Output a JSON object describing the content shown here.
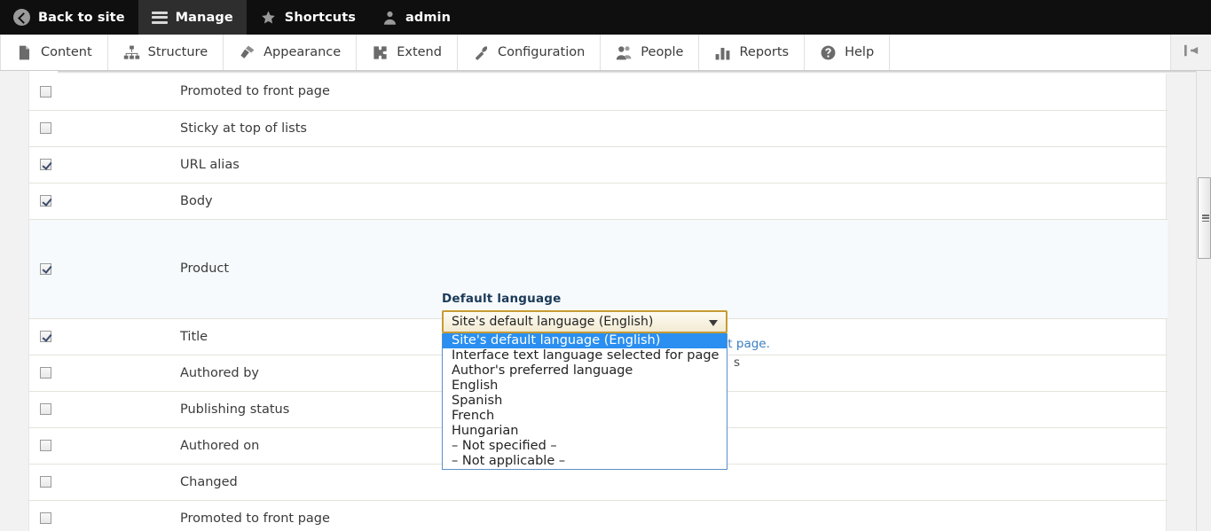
{
  "toolbar": {
    "items": [
      {
        "label": "Back to site",
        "icon": "back-circle-icon",
        "active": false
      },
      {
        "label": "Manage",
        "icon": "hamburger-icon",
        "active": true
      },
      {
        "label": "Shortcuts",
        "icon": "star-icon",
        "active": false
      },
      {
        "label": "admin",
        "icon": "person-icon",
        "active": false
      }
    ]
  },
  "menu": {
    "items": [
      {
        "label": "Content",
        "icon": "document-icon"
      },
      {
        "label": "Structure",
        "icon": "sitemap-icon"
      },
      {
        "label": "Appearance",
        "icon": "paintbrush-icon"
      },
      {
        "label": "Extend",
        "icon": "puzzle-icon"
      },
      {
        "label": "Configuration",
        "icon": "wrench-icon"
      },
      {
        "label": "People",
        "icon": "people-icon"
      },
      {
        "label": "Reports",
        "icon": "bar-chart-icon"
      },
      {
        "label": "Help",
        "icon": "question-circle-icon"
      }
    ],
    "toggle_icon": "collapse-toolbar-icon"
  },
  "settings_table": {
    "rows": [
      {
        "label": "Promoted to front page",
        "checked": false,
        "expanded": false
      },
      {
        "label": "Sticky at top of lists",
        "checked": false,
        "expanded": false
      },
      {
        "label": "URL alias",
        "checked": true,
        "expanded": false
      },
      {
        "label": "Body",
        "checked": true,
        "expanded": false
      },
      {
        "label": "Product",
        "checked": true,
        "expanded": true
      },
      {
        "label": "Title",
        "checked": true,
        "expanded": false
      },
      {
        "label": "Authored by",
        "checked": false,
        "expanded": false
      },
      {
        "label": "Publishing status",
        "checked": false,
        "expanded": false
      },
      {
        "label": "Authored on",
        "checked": false,
        "expanded": false
      },
      {
        "label": "Changed",
        "checked": false,
        "expanded": false
      },
      {
        "label": "Promoted to front page",
        "checked": false,
        "expanded": false
      }
    ]
  },
  "language_widget": {
    "label": "Default language",
    "selected": "Site's default language (English)",
    "options": [
      {
        "text": "Site's default language (English)",
        "selected": true
      },
      {
        "text": "Interface text language selected for page",
        "selected": false
      },
      {
        "text": "Author's preferred language",
        "selected": false
      },
      {
        "text": "English",
        "selected": false
      },
      {
        "text": "Spanish",
        "selected": false
      },
      {
        "text": "French",
        "selected": false
      },
      {
        "text": "Hungarian",
        "selected": false
      },
      {
        "text": "– Not specified –",
        "selected": false
      },
      {
        "text": "– Not applicable –",
        "selected": false
      }
    ],
    "caret_icon": "chevron-down-icon",
    "description_visible_tail": "guages list page.",
    "description_visible_tail2": "s"
  },
  "colors": {
    "toolbar_bg": "#0f0f0f",
    "toolbar_active_bg": "#2e2e2e",
    "menu_text": "#3b3b3b",
    "select_border": "#c79a33",
    "option_highlight": "#2a8ff0",
    "expanded_row_bg": "#f6fafd",
    "link": "#3a7ec0"
  }
}
